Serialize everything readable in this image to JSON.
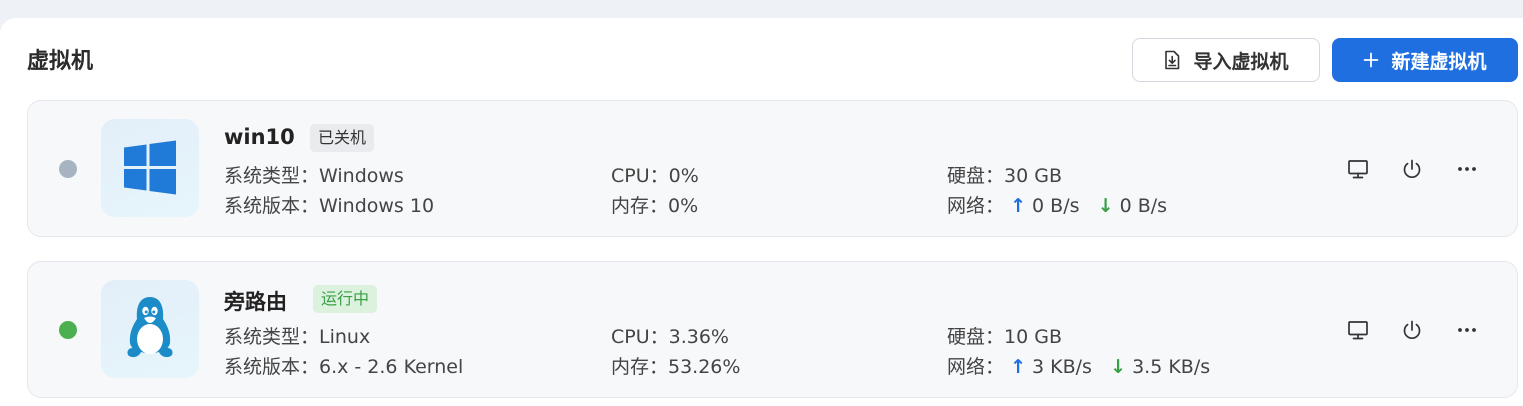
{
  "page": {
    "title": "虚拟机",
    "import_label": "导入虚拟机",
    "new_label": "新建虚拟机"
  },
  "vms": [
    {
      "name": "win10",
      "status": "已关机",
      "os_type": "系统类型：Windows",
      "os_version": "系统版本：Windows 10",
      "cpu": "CPU：0%",
      "memory": "内存：0%",
      "disk": "硬盘：30 GB",
      "network_label": "网络：",
      "net_up": "0 B/s",
      "net_down": "0 B/s",
      "status_color": "#a8b3c2",
      "icon": "windows-logo"
    },
    {
      "name": "旁路由",
      "status": "运行中",
      "os_type": "系统类型：Linux",
      "os_version": "系统版本：6.x - 2.6 Kernel",
      "cpu": "CPU：3.36%",
      "memory": "内存：53.26%",
      "disk": "硬盘：10 GB",
      "network_label": "网络：",
      "net_up": "3 KB/s",
      "net_down": "3.5 KB/s",
      "status_color": "#4caf50",
      "icon": "linux-tux-logo"
    }
  ],
  "colors": {
    "accent": "#1f6fe0",
    "running": "#3aa046",
    "stopped": "#a8b3c2"
  }
}
